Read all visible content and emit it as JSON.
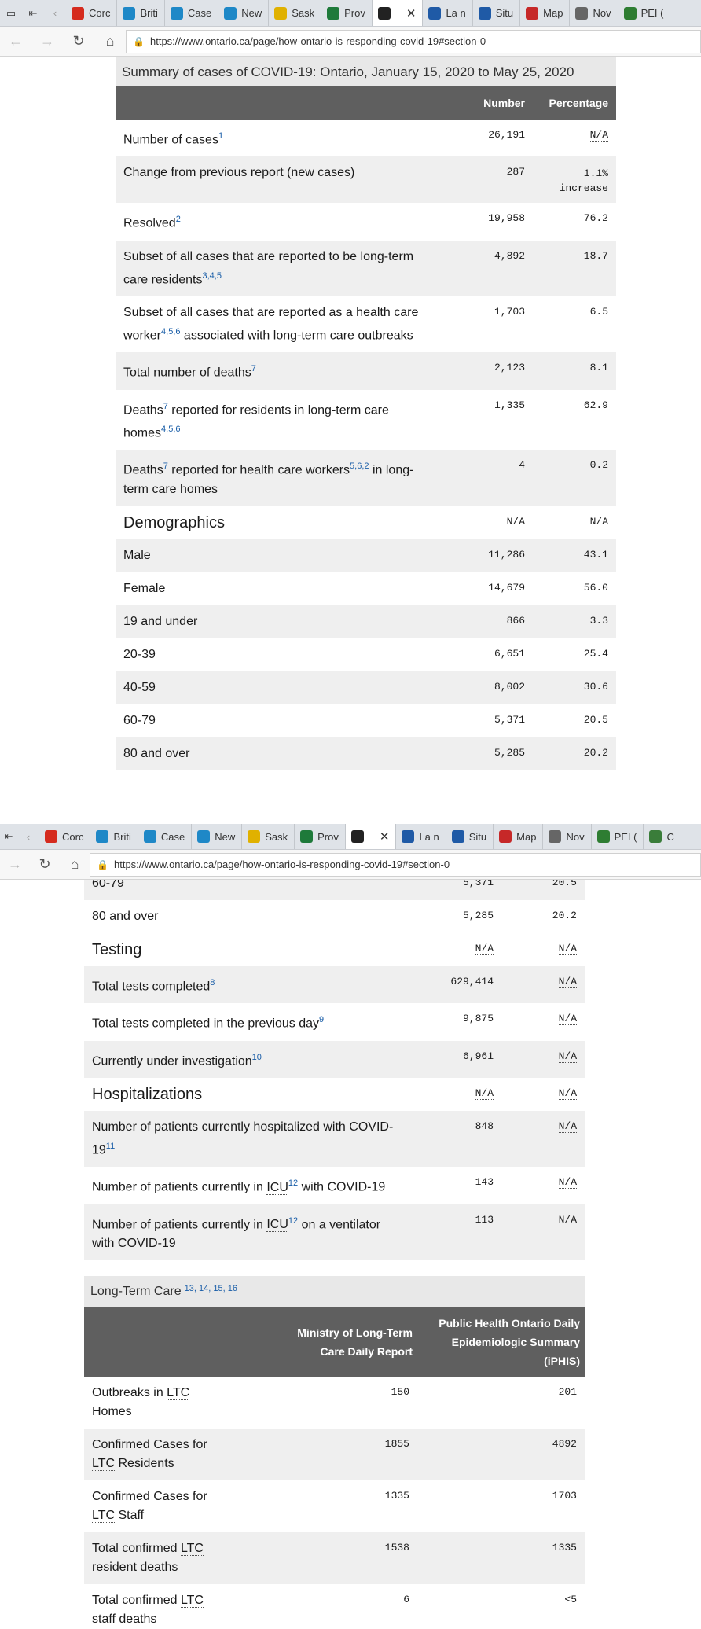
{
  "browser": {
    "tabs": [
      {
        "label": "Corc",
        "icon": "maple-leaf-icon",
        "color": "#d52b1e"
      },
      {
        "label": "Briti",
        "icon": "globe-icon",
        "color": "#1e88c7"
      },
      {
        "label": "Case",
        "icon": "chart-icon",
        "color": "#1e88c7"
      },
      {
        "label": "New",
        "icon": "chart-icon",
        "color": "#1e88c7"
      },
      {
        "label": "Sask",
        "icon": "flower-icon",
        "color": "#e0b100"
      },
      {
        "label": "Prov",
        "icon": "sheet-icon",
        "color": "#1e7a3a"
      },
      {
        "label": "",
        "icon": "shield-icon",
        "color": "#222222",
        "active": true
      },
      {
        "label": "La n",
        "icon": "fleur-icon",
        "color": "#1f5aa6"
      },
      {
        "label": "Situ",
        "icon": "fleur-icon",
        "color": "#1f5aa6"
      },
      {
        "label": "Map",
        "icon": "map-icon",
        "color": "#c62828"
      },
      {
        "label": "Nov",
        "icon": "document-icon",
        "color": "#666666"
      },
      {
        "label": "PEI (",
        "icon": "island-icon",
        "color": "#2e7d32"
      }
    ],
    "tabs2_extra": {
      "label": "C",
      "icon": "globe-icon",
      "color": "#3a7d3a"
    },
    "url": "https://www.ontario.ca/page/how-ontario-is-responding-covid-19#section-0"
  },
  "summary": {
    "caption": "Summary of cases of COVID-19: Ontario, January 15, 2020 to May 25, 2020",
    "col_number": "Number",
    "col_percentage": "Percentage",
    "rows": [
      {
        "label": "Number of cases",
        "sup": "1",
        "number": "26,191",
        "pct": "N/A",
        "pct_ul": true
      },
      {
        "label": "Change from previous report (new cases)",
        "sup": "",
        "number": "287",
        "pct": "1.1%",
        "pct2": "increase"
      },
      {
        "label": "Resolved",
        "sup": "2",
        "number": "19,958",
        "pct": "76.2"
      },
      {
        "label": "Subset of all cases that are reported to be long-term",
        "label2": "care residents",
        "sup": "3,4,5",
        "number": "4,892",
        "pct": "18.7"
      },
      {
        "label": "Subset of all cases that are reported as a health care",
        "label2a": "worker",
        "sup": "4,5,6",
        "label2b": " associated with long-term care outbreaks",
        "number": "1,703",
        "pct": "6.5"
      },
      {
        "label": "Total number of deaths",
        "sup": "7",
        "number": "2,123",
        "pct": "8.1"
      },
      {
        "label": "Deaths",
        "sup": "7",
        "label_rest": " reported for residents in long-term care",
        "label2": "homes",
        "sup2": "4,5,6",
        "number": "1,335",
        "pct": "62.9"
      },
      {
        "label": "Deaths",
        "sup": "7",
        "label_rest": " reported for health care workers",
        "sup3": "5,6,2",
        "label_rest2": " in long-",
        "label2": "term care homes",
        "number": "4",
        "pct": "0.2"
      }
    ],
    "demographics": {
      "heading": "Demographics",
      "number": "N/A",
      "pct": "N/A",
      "rows": [
        {
          "label": "Male",
          "number": "11,286",
          "pct": "43.1"
        },
        {
          "label": "Female",
          "number": "14,679",
          "pct": "56.0"
        },
        {
          "label": "19 and under",
          "number": "866",
          "pct": "3.3"
        },
        {
          "label": "20-39",
          "number": "6,651",
          "pct": "25.4"
        },
        {
          "label": "40-59",
          "number": "8,002",
          "pct": "30.6"
        },
        {
          "label": "60-79",
          "number": "5,371",
          "pct": "20.5"
        },
        {
          "label": "80 and over",
          "number": "5,285",
          "pct": "20.2"
        }
      ]
    },
    "testing": {
      "heading": "Testing",
      "number": "N/A",
      "pct": "N/A",
      "rows": [
        {
          "label": "Total tests completed",
          "sup": "8",
          "number": "629,414",
          "pct": "N/A"
        },
        {
          "label": "Total tests completed in the previous day",
          "sup": "9",
          "number": "9,875",
          "pct": "N/A"
        },
        {
          "label": "Currently under investigation",
          "sup": "10",
          "number": "6,961",
          "pct": "N/A"
        }
      ]
    },
    "hospitalizations": {
      "heading": "Hospitalizations",
      "number": "N/A",
      "pct": "N/A",
      "rows": [
        {
          "label": "Number of patients currently hospitalized with COVID-",
          "label2": "19",
          "sup": "11",
          "number": "848",
          "pct": "N/A"
        },
        {
          "label_pre": "Number of patients currently in ",
          "abbr": "ICU",
          "sup": "12",
          "label_post": " with COVID-19",
          "number": "143",
          "pct": "N/A"
        },
        {
          "label_pre": "Number of patients currently in ",
          "abbr": "ICU",
          "sup": "12",
          "label_post": " on a ventilator",
          "label2": "with COVID-19",
          "number": "113",
          "pct": "N/A"
        }
      ]
    }
  },
  "ltc": {
    "caption": "Long-Term Care",
    "caption_sups": [
      "13",
      "14",
      "15",
      "16"
    ],
    "col1": [
      "Ministry of Long-Term",
      "Care Daily Report"
    ],
    "col2": [
      "Public Health Ontario Daily",
      "Epidemiologic Summary (iPHIS)"
    ],
    "rows": [
      {
        "label": [
          "Outbreaks in ",
          "LTC",
          "Homes"
        ],
        "ministry": "150",
        "phis": "201"
      },
      {
        "label": [
          "Confirmed Cases for",
          "LTC",
          " Residents"
        ],
        "ministry": "1855",
        "phis": "4892"
      },
      {
        "label": [
          "Confirmed Cases for",
          "LTC",
          " Staff"
        ],
        "ministry": "1335",
        "phis": "1703"
      },
      {
        "label": [
          "Total confirmed ",
          "LTC",
          "resident deaths"
        ],
        "ministry": "1538",
        "phis": "1335"
      },
      {
        "label": [
          "Total confirmed ",
          "LTC",
          "staff deaths"
        ],
        "ministry": "6",
        "phis": "<5"
      }
    ]
  }
}
